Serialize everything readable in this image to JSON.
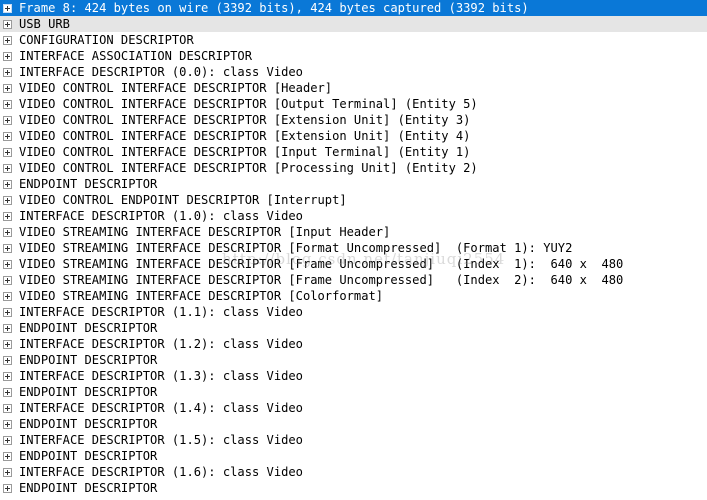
{
  "packet_details": {
    "rows": [
      {
        "label": "Frame 8: 424 bytes on wire (3392 bits), 424 bytes captured (3392 bits)",
        "state": "selected"
      },
      {
        "label": "USB URB",
        "state": "hover"
      },
      {
        "label": "CONFIGURATION DESCRIPTOR",
        "state": "normal"
      },
      {
        "label": "INTERFACE ASSOCIATION DESCRIPTOR",
        "state": "normal"
      },
      {
        "label": "INTERFACE DESCRIPTOR (0.0): class Video",
        "state": "normal"
      },
      {
        "label": "VIDEO CONTROL INTERFACE DESCRIPTOR [Header]",
        "state": "normal"
      },
      {
        "label": "VIDEO CONTROL INTERFACE DESCRIPTOR [Output Terminal] (Entity 5)",
        "state": "normal"
      },
      {
        "label": "VIDEO CONTROL INTERFACE DESCRIPTOR [Extension Unit] (Entity 3)",
        "state": "normal"
      },
      {
        "label": "VIDEO CONTROL INTERFACE DESCRIPTOR [Extension Unit] (Entity 4)",
        "state": "normal"
      },
      {
        "label": "VIDEO CONTROL INTERFACE DESCRIPTOR [Input Terminal] (Entity 1)",
        "state": "normal"
      },
      {
        "label": "VIDEO CONTROL INTERFACE DESCRIPTOR [Processing Unit] (Entity 2)",
        "state": "normal"
      },
      {
        "label": "ENDPOINT DESCRIPTOR",
        "state": "normal"
      },
      {
        "label": "VIDEO CONTROL ENDPOINT DESCRIPTOR [Interrupt]",
        "state": "normal"
      },
      {
        "label": "INTERFACE DESCRIPTOR (1.0): class Video",
        "state": "normal"
      },
      {
        "label": "VIDEO STREAMING INTERFACE DESCRIPTOR [Input Header]",
        "state": "normal"
      },
      {
        "label": "VIDEO STREAMING INTERFACE DESCRIPTOR [Format Uncompressed]  (Format 1): YUY2",
        "state": "normal"
      },
      {
        "label": "VIDEO STREAMING INTERFACE DESCRIPTOR [Frame Uncompressed]   (Index  1):  640 x  480",
        "state": "normal"
      },
      {
        "label": "VIDEO STREAMING INTERFACE DESCRIPTOR [Frame Uncompressed]   (Index  2):  640 x  480",
        "state": "normal"
      },
      {
        "label": "VIDEO STREAMING INTERFACE DESCRIPTOR [Colorformat]",
        "state": "normal"
      },
      {
        "label": "INTERFACE DESCRIPTOR (1.1): class Video",
        "state": "normal"
      },
      {
        "label": "ENDPOINT DESCRIPTOR",
        "state": "normal"
      },
      {
        "label": "INTERFACE DESCRIPTOR (1.2): class Video",
        "state": "normal"
      },
      {
        "label": "ENDPOINT DESCRIPTOR",
        "state": "normal"
      },
      {
        "label": "INTERFACE DESCRIPTOR (1.3): class Video",
        "state": "normal"
      },
      {
        "label": "ENDPOINT DESCRIPTOR",
        "state": "normal"
      },
      {
        "label": "INTERFACE DESCRIPTOR (1.4): class Video",
        "state": "normal"
      },
      {
        "label": "ENDPOINT DESCRIPTOR",
        "state": "normal"
      },
      {
        "label": "INTERFACE DESCRIPTOR (1.5): class Video",
        "state": "normal"
      },
      {
        "label": "ENDPOINT DESCRIPTOR",
        "state": "normal"
      },
      {
        "label": "INTERFACE DESCRIPTOR (1.6): class Video",
        "state": "normal"
      },
      {
        "label": "ENDPOINT DESCRIPTOR",
        "state": "normal"
      }
    ]
  },
  "watermark": {
    "text": "http://blog.csdn.net/tanjiuqi2554"
  },
  "colors": {
    "selection": "#0a78d7",
    "hover": "#e5e5e5"
  }
}
